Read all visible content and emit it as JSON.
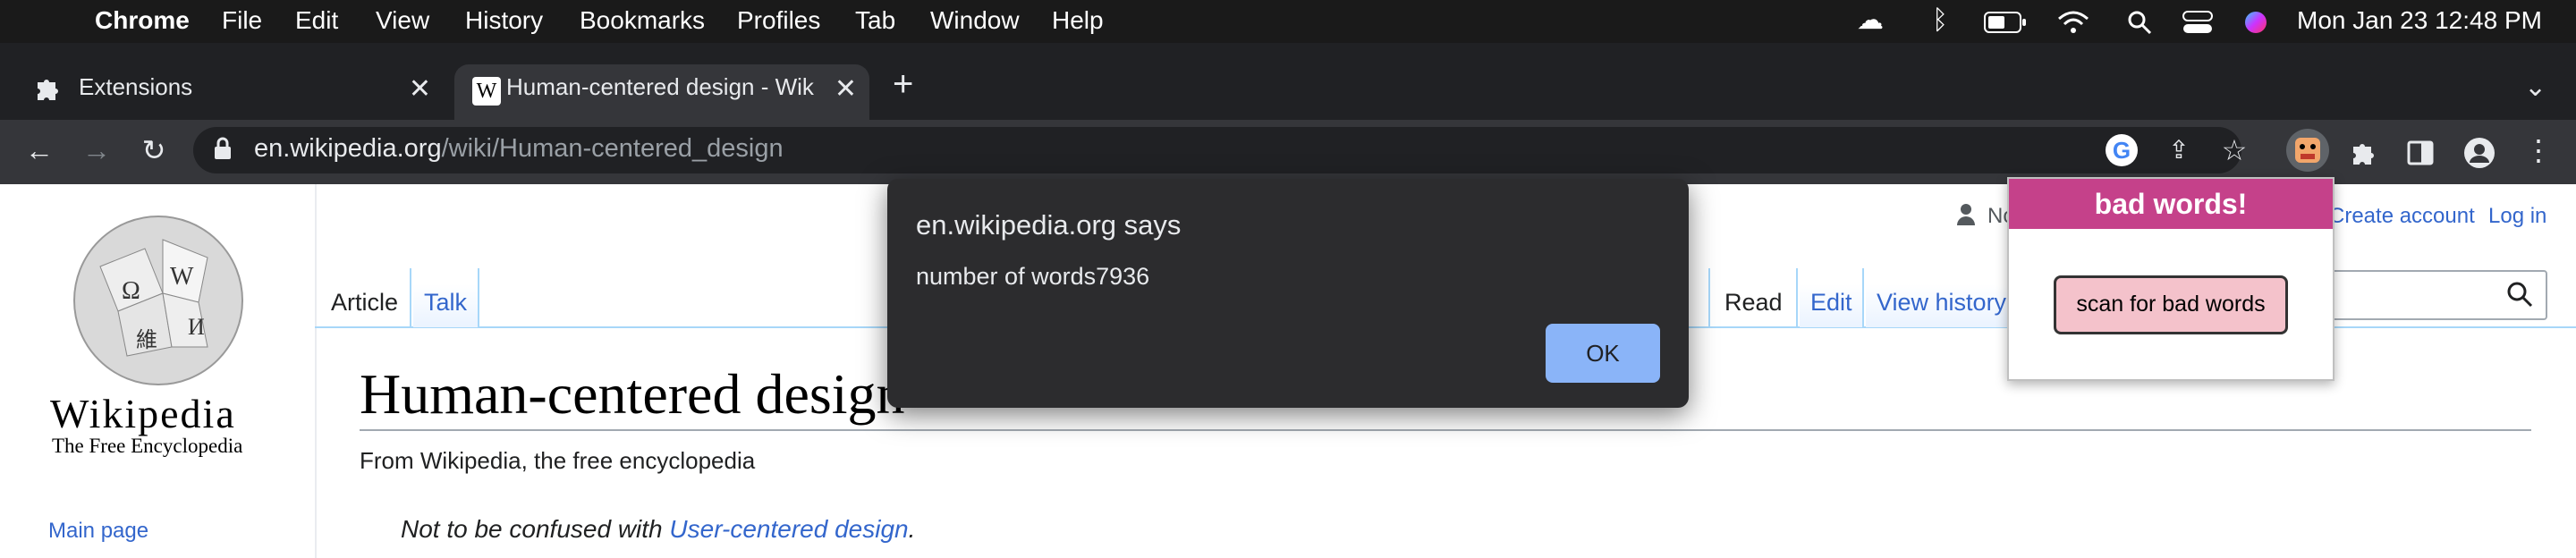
{
  "menubar": {
    "app": "Chrome",
    "items": [
      "File",
      "Edit",
      "View",
      "History",
      "Bookmarks",
      "Profiles",
      "Tab",
      "Window",
      "Help"
    ],
    "clock": "Mon Jan 23  12:48 PM"
  },
  "tabs": [
    {
      "title": "Extensions",
      "icon": "puzzle-icon"
    },
    {
      "title": "Human-centered design - Wiki",
      "icon": "wikipedia-w-icon"
    }
  ],
  "address_bar": {
    "host": "en.wikipedia.org",
    "path": "/wiki/Human-centered_design"
  },
  "wikipedia": {
    "wordmark": "Wikipedia",
    "tagline": "The Free Encyclopedia",
    "nav": {
      "main_page": "Main page"
    },
    "tabs": {
      "article": "Article",
      "talk": "Talk",
      "read": "Read",
      "edit": "Edit",
      "history": "View history"
    },
    "user_tools": {
      "not_logged": "No",
      "create_account": "Create account",
      "log_in": "Log in"
    },
    "title": "Human-centered design",
    "from": "From Wikipedia, the free encyclopedia",
    "hatnote_prefix": "Not to be confused with ",
    "hatnote_link": "User-centered design",
    "hatnote_suffix": "."
  },
  "alert": {
    "title": "en.wikipedia.org says",
    "message": "number of words7936",
    "ok": "OK"
  },
  "extension_popup": {
    "title": "bad words!",
    "button": "scan for bad words",
    "accent": "#c5418a",
    "button_color": "#f4c2cb"
  }
}
